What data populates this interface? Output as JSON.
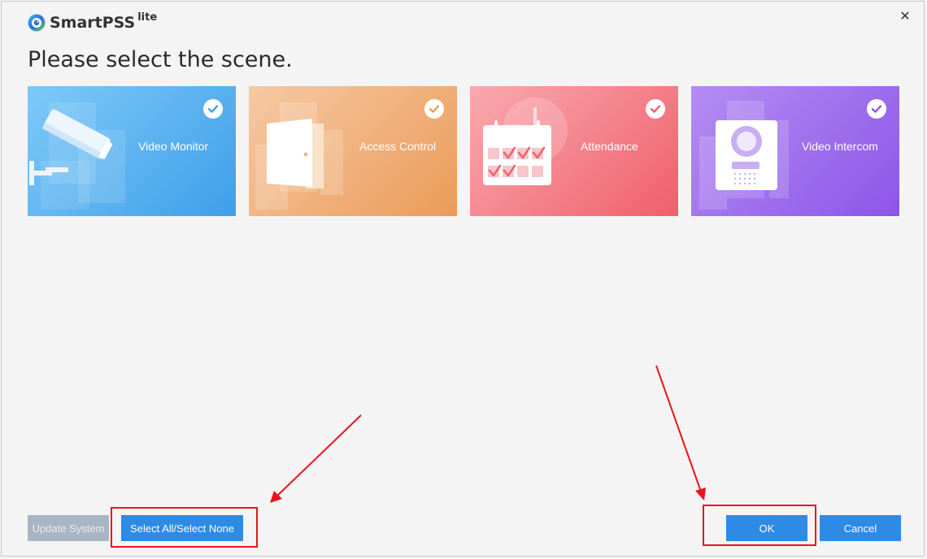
{
  "app": {
    "name": "SmartPSS",
    "edition": "lite"
  },
  "heading": "Please select the scene.",
  "scenes": [
    {
      "label": "Video Monitor",
      "selected": true,
      "icon": "camera-icon"
    },
    {
      "label": "Access Control",
      "selected": true,
      "icon": "door-icon"
    },
    {
      "label": "Attendance",
      "selected": true,
      "icon": "calendar-icon"
    },
    {
      "label": "Video Intercom",
      "selected": true,
      "icon": "intercom-icon"
    }
  ],
  "buttons": {
    "update_system": "Update System",
    "select_all": "Select All/Select None",
    "ok": "OK",
    "cancel": "Cancel"
  },
  "colors": {
    "primary_button": "#2d8be6",
    "disabled_button": "#a9b5c3",
    "annotation_red": "#e8141d"
  }
}
